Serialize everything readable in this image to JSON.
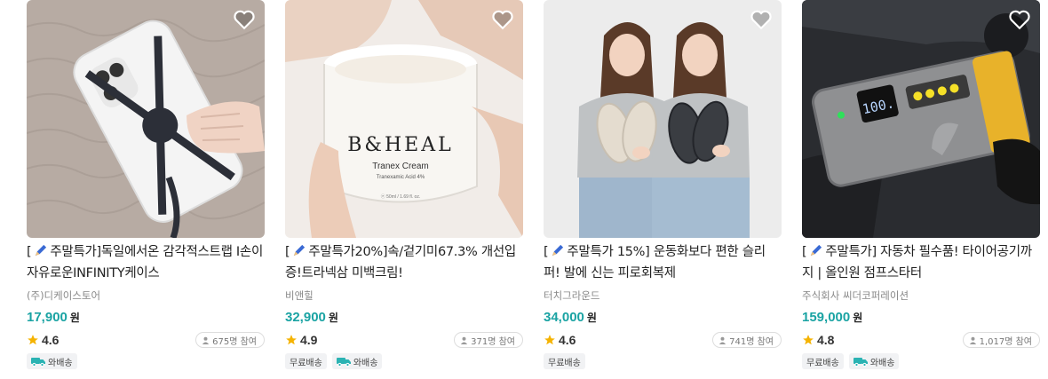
{
  "products": [
    {
      "title_prefix": "[",
      "title_text": "주말특가]독일에서온 감각적스트랩 I손이 자유로운INFINITY케이스",
      "seller": "(주)디케이스토어",
      "price": "17,900",
      "currency": "원",
      "rating": "4.6",
      "participants": "675명 참여",
      "tags": [
        {
          "label": "와배송",
          "icon": "truck-icon"
        }
      ],
      "image": "phone-case-strap-photo"
    },
    {
      "title_prefix": "[",
      "title_text": "주말특가20%]속/겉기미67.3% 개선입증!트라넥삼 미백크림!",
      "seller": "비앤힐",
      "price": "32,900",
      "currency": "원",
      "rating": "4.9",
      "participants": "371명 참여",
      "tags": [
        {
          "label": "무료배송",
          "icon": ""
        },
        {
          "label": "와배송",
          "icon": "truck-icon"
        }
      ],
      "image": "cream-jar-photo",
      "jar_brand": "B&HEAL",
      "jar_product": "Tranex Cream",
      "jar_sub": "Tranexamic Acid 4%",
      "jar_size": "ⓔ 50ml / 1.69 fl. oz."
    },
    {
      "title_prefix": "[",
      "title_text": "주말특가 15%] 운동화보다 편한 슬리퍼! 발에 신는 피로회복제",
      "seller": "터치그라운드",
      "price": "34,000",
      "currency": "원",
      "rating": "4.6",
      "participants": "741명 참여",
      "tags": [
        {
          "label": "무료배송",
          "icon": ""
        }
      ],
      "image": "slippers-twins-photo"
    },
    {
      "title_prefix": "[",
      "title_text": "주말특가] 자동차 필수품! 타이어공기까지 | 올인원 점프스타터",
      "seller": "주식회사 씨더코퍼레이션",
      "price": "159,000",
      "currency": "원",
      "rating": "4.8",
      "participants": "1,017명 참여",
      "tags": [
        {
          "label": "무료배송",
          "icon": ""
        },
        {
          "label": "와배송",
          "icon": "truck-icon"
        }
      ],
      "image": "jump-starter-photo",
      "display_value": "100."
    }
  ],
  "colors": {
    "price": "#1aa3a3",
    "star": "#f5b301",
    "truck": "#2bb3b3"
  }
}
